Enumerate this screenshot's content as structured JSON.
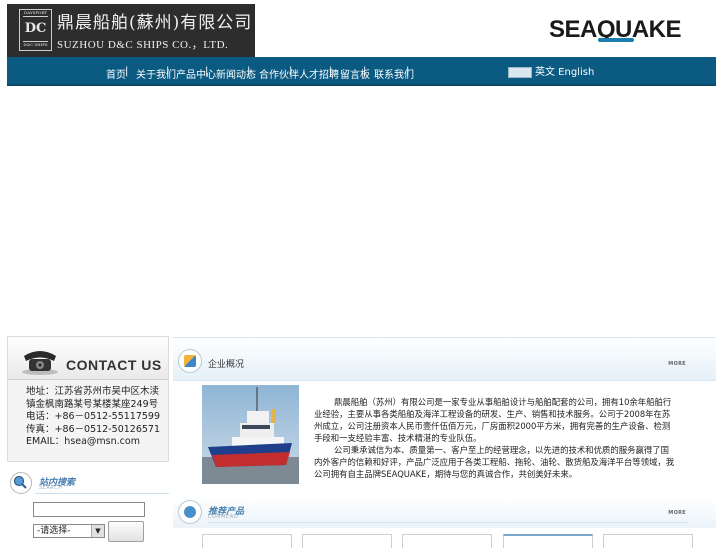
{
  "header": {
    "logo_mark_top": "DAYSPORT",
    "logo_mark_letters": "DC",
    "logo_mark_bottom": "D&C SHIPS",
    "company_name_cn": "鼎晨船舶(蘇州)有限公司",
    "company_name_en": "SUZHOU   D&C SHIPS CO.，LTD.",
    "brand": "SEAQUAKE"
  },
  "nav": {
    "items": [
      "首页",
      "关于我们",
      "产品中心",
      "新闻动态",
      "合作伙伴",
      "人才招聘",
      "留言板",
      "联系我们"
    ],
    "separator": "|",
    "language": "英文 English"
  },
  "contact": {
    "title": "CONTACT US",
    "address": "地址：江苏省苏州市吴中区木渎镇金枫南路某号某楼某座249号",
    "phone": "电话：+86－0512-55117599",
    "fax": "传真：+86－0512-50126571",
    "email": "EMAIL：hsea@msn.com"
  },
  "search": {
    "title": "站内搜索",
    "title_en": "SEARCH",
    "input_value": "",
    "select_value": "-请选择-"
  },
  "about": {
    "title": "企业概况",
    "more": "MORE",
    "text_1": "鼎晨船舶（苏州）有限公司是一家专业从事船舶设计与船舶配套的公司，拥有10余年船舶行业经验，主要从事各类船舶及海洋工程设备的研发、生产、销售和技术服务。公司于2008年在苏州成立，公司注册资本人民币壹仟伍佰万元，厂房面积2000平方米，拥有完善的生产设备、检测手段和一支经验丰富、技术精湛的专业队伍。",
    "text_2": "公司秉承诚信为本、质量第一、客户至上的经营理念，以先进的技术和优质的服务赢得了国内外客户的信赖和好评，产品广泛应用于各类工程船、拖轮、油轮、散货船及海洋平台等领域，我公司拥有自主品牌SEAQUAKE，期待与您的真诚合作，共创美好未来。"
  },
  "products": {
    "title": "推荐产品",
    "title_en": "COMMEND",
    "more": "MORE"
  },
  "colors": {
    "nav_bg": "#0a5a82",
    "logo_bg": "#2d2d2d",
    "brand_wave": "#1a7fb0",
    "section_header": "#e4f0f8"
  }
}
